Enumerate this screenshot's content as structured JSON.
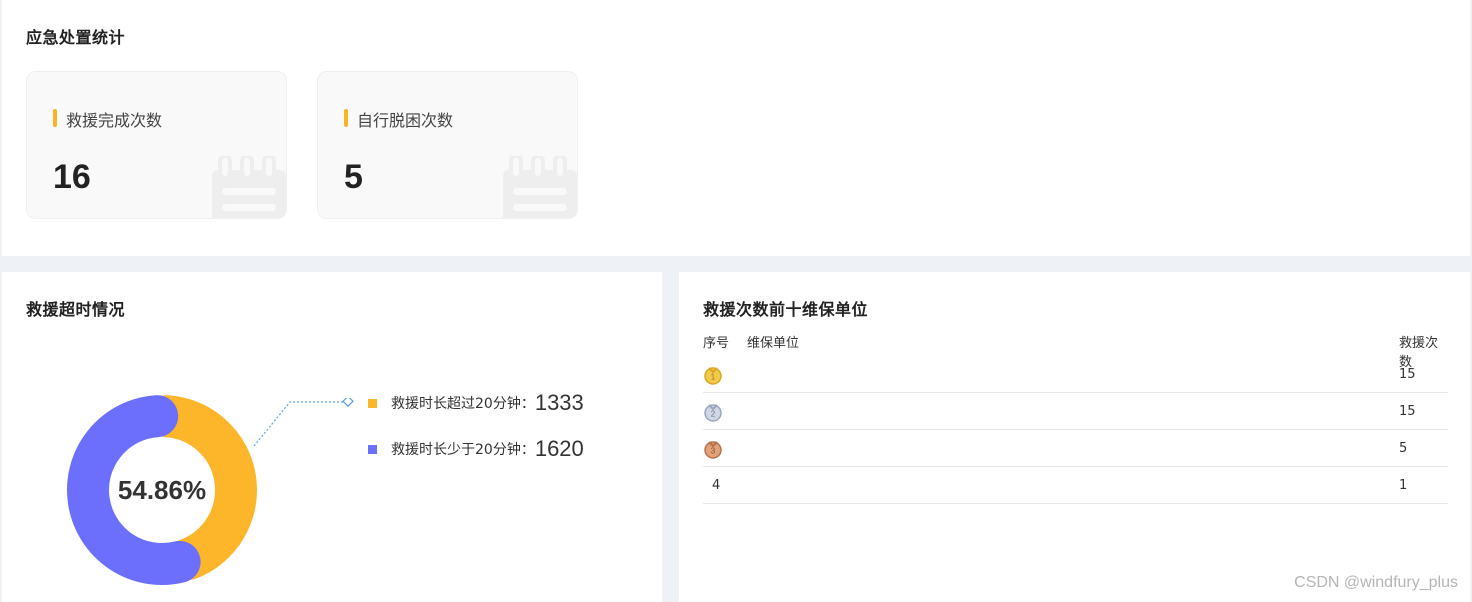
{
  "top_panel": {
    "title": "应急处置统计",
    "cards": [
      {
        "label": "救援完成次数",
        "value": "16"
      },
      {
        "label": "自行脱困次数",
        "value": "5"
      }
    ]
  },
  "timeout_panel": {
    "title": "救援超时情况",
    "center_percent": "54.86%",
    "legend": [
      {
        "label": "救援时长超过20分钟：",
        "value": "1333",
        "color": "#fdb52a"
      },
      {
        "label": "救援时长少于20分钟：",
        "value": "1620",
        "color": "#6c6efc"
      }
    ]
  },
  "chart_data": {
    "type": "pie",
    "title": "救援超时情况",
    "series": [
      {
        "name": "救援时长超过20分钟",
        "value": 1333,
        "color": "#fdb52a"
      },
      {
        "name": "救援时长少于20分钟",
        "value": 1620,
        "color": "#6c6efc"
      }
    ],
    "center_label": "54.86%"
  },
  "ranking_panel": {
    "title": "救援次数前十维保单位",
    "headers": {
      "no": "序号",
      "unit": "维保单位",
      "count": "救援次数"
    },
    "rows": [
      {
        "rank": "1",
        "medal": "gold-medal-icon",
        "unit": "",
        "count": "15"
      },
      {
        "rank": "2",
        "medal": "silver-medal-icon",
        "unit": "",
        "count": "15"
      },
      {
        "rank": "3",
        "medal": "bronze-medal-icon",
        "unit": "",
        "count": "5"
      },
      {
        "rank": "4",
        "medal": "",
        "unit": "",
        "count": "1"
      }
    ]
  },
  "watermark": "CSDN @windfury_plus"
}
